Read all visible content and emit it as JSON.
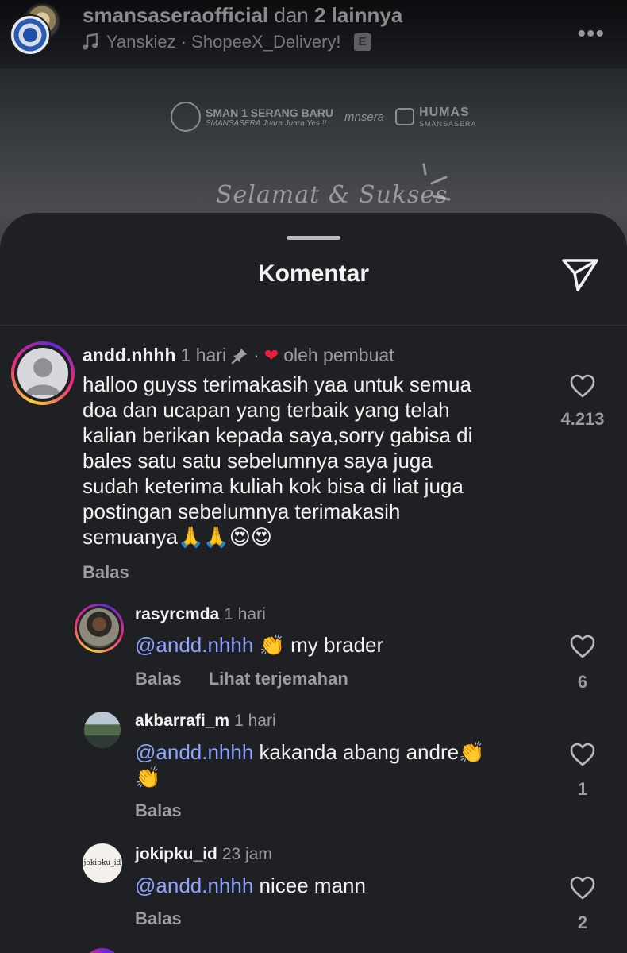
{
  "post": {
    "username": "smansaseraofficial",
    "connector": "dan",
    "others": "2 lainnya",
    "music": "Yanskiez · ShopeeX_Delivery!",
    "explicit": "E",
    "logo_school": "SMAN 1 SERANG BARU",
    "logo_school_tagline": "SMANSASERA Juara Juara Yes !!",
    "logo_msera": "mnsera",
    "logo_humas": "HUMAS",
    "logo_humas_sub": "SMANSASERA",
    "slogan": "Selamat & Sukses"
  },
  "sheet": {
    "title": "Komentar"
  },
  "comments": [
    {
      "username": "andd.nhhh",
      "time": "1 hari",
      "dot": "·",
      "by_creator": "oleh pembuat",
      "lines": [
        "halloo guyss terimakasih yaa untuk semua",
        "doa dan ucapan yang terbaik yang telah",
        "kalian berikan kepada saya,sorry gabisa di",
        "bales satu satu sebelumnya saya juga",
        "sudah keterima kuliah kok bisa di liat juga",
        "postingan sebelumnya terimakasih",
        "semuanya"
      ],
      "emojis": "🙏🙏😍😍",
      "reply": "Balas",
      "likes": "4.213"
    },
    {
      "username": "rasyrcmda",
      "time": "1 hari",
      "mention": "@andd.nhhh",
      "text": "👏 my brader",
      "reply": "Balas",
      "translate": "Lihat terjemahan",
      "likes": "6"
    },
    {
      "username": "akbarrafi_m",
      "time": "1 hari",
      "mention": "@andd.nhhh",
      "text": "kakanda abang andre👏",
      "text2": "👏",
      "reply": "Balas",
      "likes": "1"
    },
    {
      "username": "jokipku_id",
      "time": "23 jam",
      "mention": "@andd.nhhh",
      "text": "nicee mann",
      "reply": "Balas",
      "likes": "2",
      "avatar_text": "jokipku_id"
    }
  ],
  "icons": {
    "more": "more-horizontal-icon",
    "music": "music-note-icon",
    "share": "send-paper-plane-icon",
    "pin": "pin-icon",
    "heart": "heart-outline-icon"
  },
  "colors": {
    "sheet_bg": "#1f2023",
    "mention": "#8ca3ff",
    "creator_heart": "#ee1d3c"
  }
}
